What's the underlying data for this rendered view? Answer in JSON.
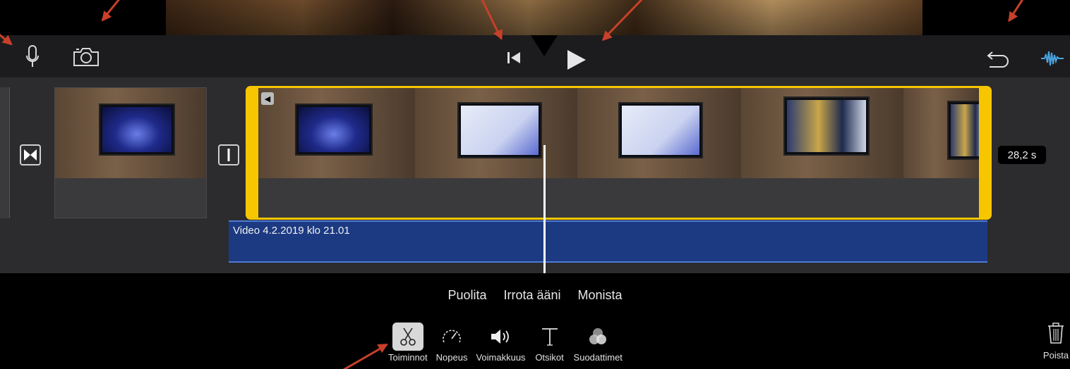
{
  "toolbar": {
    "microphone_icon": "microphone-icon",
    "camera_icon": "camera-icon",
    "skip_back_icon": "skip-to-start-icon",
    "play_icon": "play-icon",
    "undo_icon": "undo-icon",
    "audio_waveform_icon": "audio-waveform-icon",
    "waveform_color": "#4aa3df"
  },
  "timeline": {
    "transition_icon_1": "transition-bowtie-icon",
    "transition_icon_2": "transition-cut-icon",
    "selected_clip_duration": "28,2 s",
    "audio_track_label": "Video 4.2.2019 klo 21.01",
    "selection_color": "#f7c600",
    "audio_track_color": "#1c3a82"
  },
  "actions": [
    "Puolita",
    "Irrota ääni",
    "Monista"
  ],
  "tools": [
    {
      "label": "Toiminnot",
      "icon": "scissors-icon",
      "active": true
    },
    {
      "label": "Nopeus",
      "icon": "speedometer-icon",
      "active": false
    },
    {
      "label": "Voimakkuus",
      "icon": "speaker-icon",
      "active": false
    },
    {
      "label": "Otsikot",
      "icon": "text-t-icon",
      "active": false
    },
    {
      "label": "Suodattimet",
      "icon": "filters-icon",
      "active": false
    }
  ],
  "delete": {
    "label": "Poista",
    "icon": "trash-icon"
  },
  "annotation_color": "#c8402a"
}
